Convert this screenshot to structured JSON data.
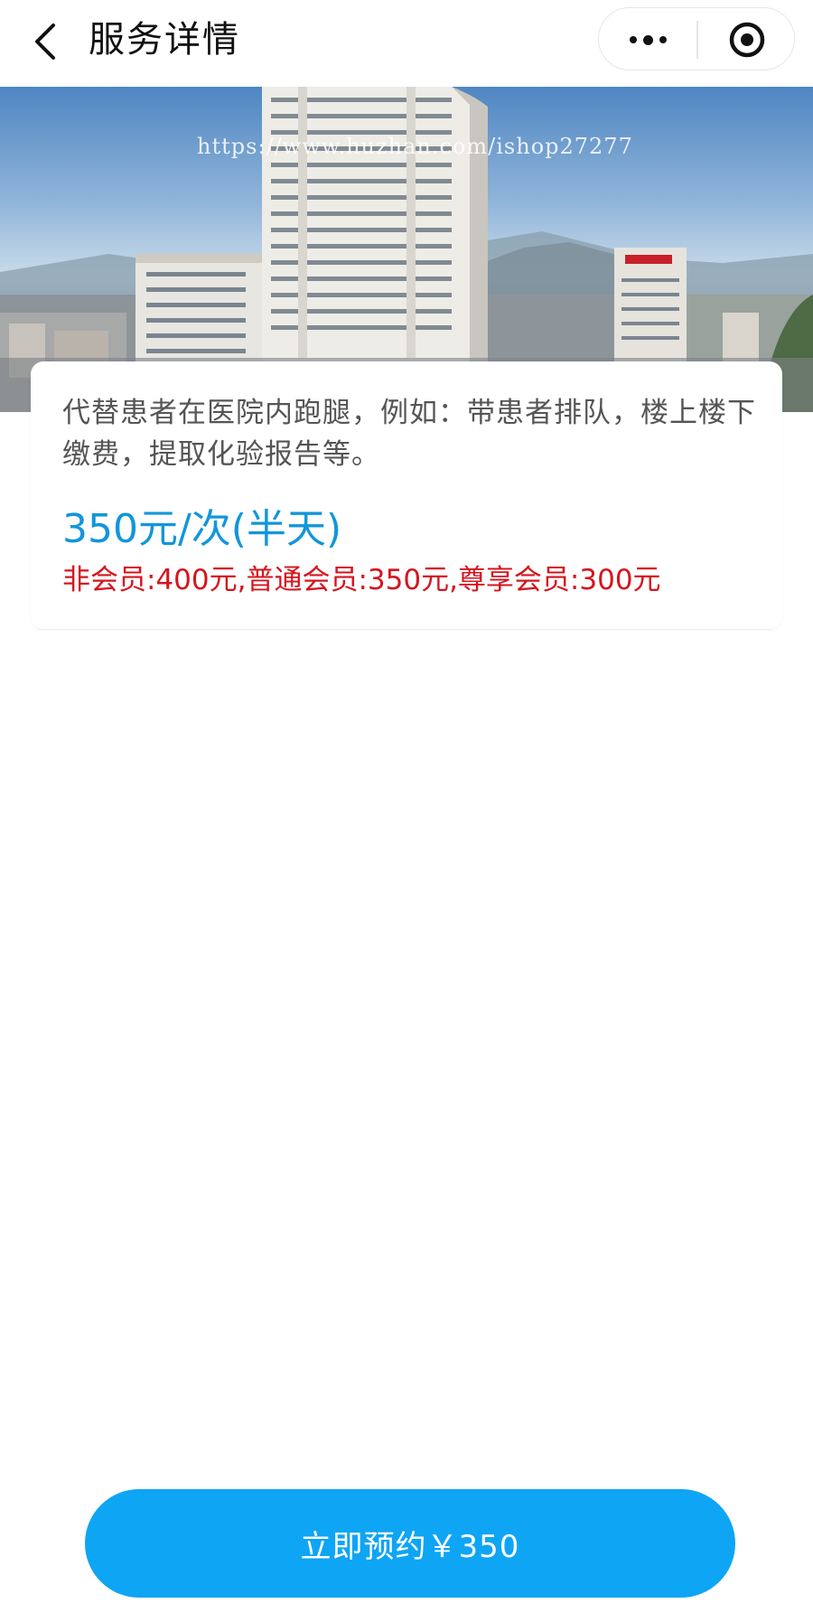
{
  "header": {
    "title": "服务详情",
    "back_icon": "chevron-left-icon",
    "more_icon": "more-dots-icon",
    "close_icon": "target-circle-icon"
  },
  "banner": {
    "image_subject": "hospital buildings under blue sky",
    "watermark": "https://www.huzhan.com/ishop27277"
  },
  "service": {
    "description": "代替患者在医院内跑腿，例如：带患者排队，楼上楼下缴费，提取化验报告等。",
    "price": "350元/次(半天)",
    "member_price": "非会员:400元,普通会员:350元,尊享会员:300元"
  },
  "footer": {
    "book_button": "立即预约￥350"
  },
  "colors": {
    "accent": "#1296db",
    "button": "#0ea5f5",
    "member_price": "#d5151e"
  }
}
